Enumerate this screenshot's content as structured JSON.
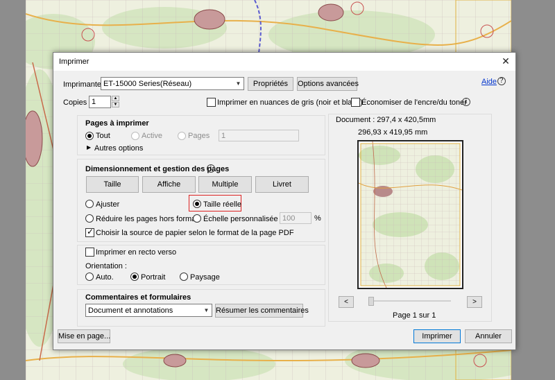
{
  "dialog": {
    "title": "Imprimer",
    "help_link": "Aide",
    "printer_label": "Imprimante :",
    "printer_value": "ET-15000 Series(Réseau)",
    "properties_button": "Propriétés",
    "advanced_button": "Options avancées",
    "copies_label": "Copies :",
    "copies_value": "1",
    "grayscale_label": "Imprimer en nuances de gris (noir et blanc)",
    "save_ink_label": "Économiser de l'encre/du toner"
  },
  "pages": {
    "heading": "Pages à imprimer",
    "all": "Tout",
    "current": "Active",
    "pages": "Pages",
    "pages_value": "1",
    "more_options": "Autres options"
  },
  "sizing": {
    "heading": "Dimensionnement et gestion des pages",
    "tabs": [
      "Taille",
      "Affiche",
      "Multiple",
      "Livret"
    ],
    "fit": "Ajuster",
    "actual_size": "Taille réelle",
    "shrink": "Réduire les pages hors format",
    "custom_scale": "Échelle personnalisée :",
    "scale_value": "100",
    "percent": "%",
    "paper_source": "Choisir la source de papier selon le format de la page PDF"
  },
  "duplex": {
    "label": "Imprimer en recto verso",
    "orientation_label": "Orientation :",
    "auto": "Auto.",
    "portrait": "Portrait",
    "landscape": "Paysage"
  },
  "comments": {
    "heading": "Commentaires et formulaires",
    "value": "Document et annotations",
    "summarize_button": "Résumer les commentaires"
  },
  "preview": {
    "document_size": "Document : 297,4 x 420,5mm",
    "paper_size": "296,93 x 419,95 mm",
    "page_indicator": "Page 1 sur 1",
    "prev": "<",
    "next": ">"
  },
  "footer": {
    "page_setup": "Mise en page...",
    "print": "Imprimer",
    "cancel": "Annuler"
  },
  "colors": {
    "accent": "#0078d7",
    "highlight": "#d22222",
    "link": "#0033cc",
    "map_bg": "#eef0df"
  }
}
